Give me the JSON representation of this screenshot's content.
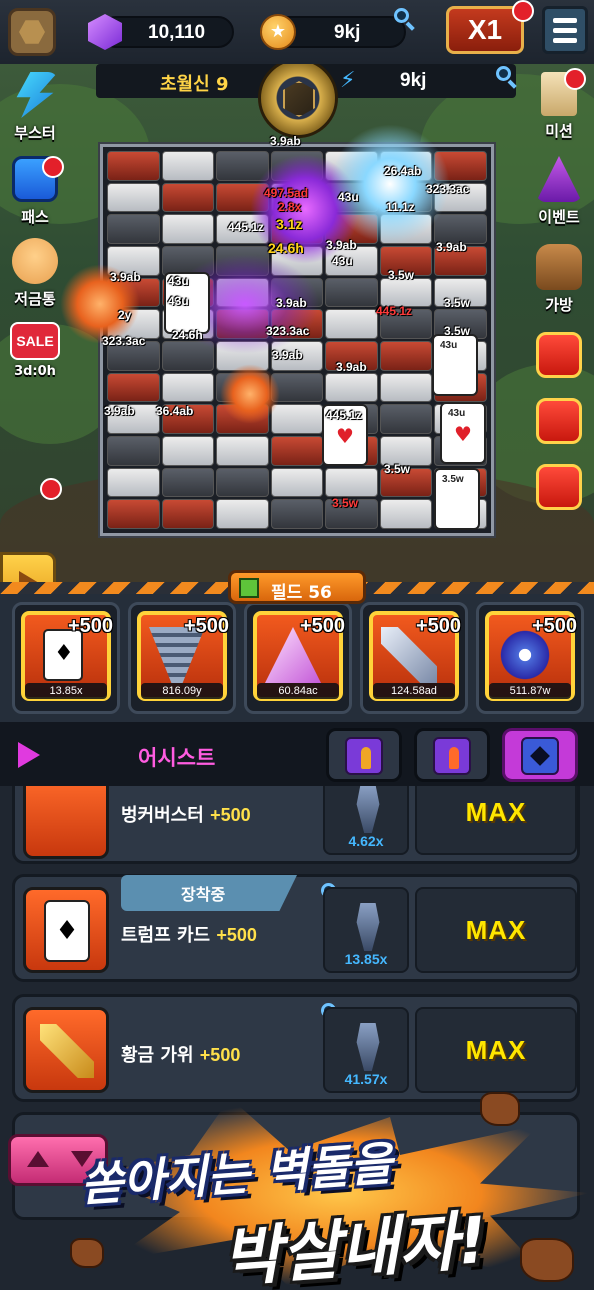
{
  "topbar": {
    "gems": "10,110",
    "coins": "9kj",
    "speed_label": "X1"
  },
  "stage": {
    "label": "초월신 9",
    "dps": "9kj"
  },
  "side_left": [
    {
      "label": "부스터"
    },
    {
      "label": "패스"
    },
    {
      "label": "저금통"
    },
    {
      "label": "SALE",
      "timer": "3d:0h"
    }
  ],
  "side_right": [
    {
      "label": "미션"
    },
    {
      "label": "이벤트"
    },
    {
      "label": "가방"
    }
  ],
  "damage_texts": [
    "3.9ab",
    "497.5ad",
    "2.8x",
    "43u",
    "26.4ab",
    "323.3ac",
    "3.1z",
    "445.1z",
    "11.1z",
    "24.6h",
    "3.9ab",
    "43u",
    "3.9ab",
    "3.9ab",
    "43u",
    "3.5w",
    "2y",
    "43u",
    "3.9ab",
    "445.1z",
    "3.5w",
    "323.3ac",
    "24.6h",
    "323.3ac",
    "3.9ab",
    "3.9ab",
    "3.9ab",
    "36.4ab",
    "445.1z",
    "43u",
    "3.5w",
    "43u",
    "3.5w",
    "3.5w"
  ],
  "speed_toggle": "x1",
  "field": {
    "label": "필드 56"
  },
  "weapons": [
    {
      "name": "trump-card",
      "bonus": "+500",
      "multiplier": "13.85x"
    },
    {
      "name": "tornado",
      "bonus": "+500",
      "multiplier": "816.09y"
    },
    {
      "name": "pyramid",
      "bonus": "+500",
      "multiplier": "60.84ac"
    },
    {
      "name": "scissors",
      "bonus": "+500",
      "multiplier": "124.58ad"
    },
    {
      "name": "fidget-spinner",
      "bonus": "+500",
      "multiplier": "511.87w"
    }
  ],
  "assist": {
    "title": "어시스트"
  },
  "assist_rows": [
    {
      "name": "벙커버스터",
      "bonus": "+500",
      "multiplier": "4.62x",
      "status": "MAX"
    },
    {
      "name": "트럼프 카드",
      "bonus": "+500",
      "multiplier": "13.85x",
      "status": "MAX",
      "tag": "장착중"
    },
    {
      "name": "황금 가위",
      "bonus": "+500",
      "multiplier": "41.57x",
      "status": "MAX"
    }
  ],
  "promo": {
    "line1": "쏟아지는 벽돌을",
    "line2": "박살내자!"
  },
  "colors": {
    "accent_gold": "#ffd447",
    "assist_magenta": "#ff5ce0",
    "max_yellow": "#ffe600",
    "multiplier_blue": "#45b8ff"
  }
}
